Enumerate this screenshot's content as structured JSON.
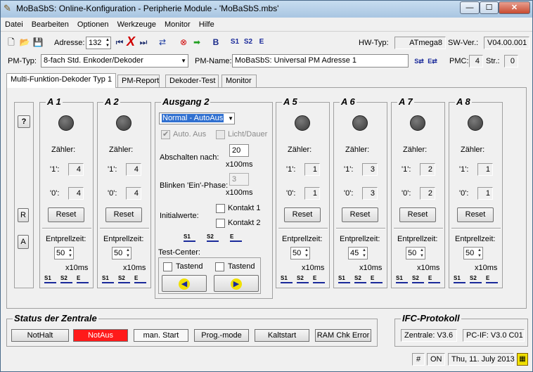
{
  "window": {
    "title": "MoBaSbS: Online-Konfiguration  -  Peripherie Module  -  'MoBaSbS.mbs'",
    "btn_min": "—",
    "btn_max": "☐",
    "btn_close": "✕"
  },
  "menu": [
    "Datei",
    "Bearbeiten",
    "Optionen",
    "Werkzeuge",
    "Monitor",
    "Hilfe"
  ],
  "toolbar": {
    "adresse_label": "Adresse:",
    "adresse_value": "132",
    "hwtyp_label": "HW-Typ:",
    "hwtyp_value": "ATmega8",
    "swver_label": "SW-Ver.:",
    "swver_value": "V04.00.001"
  },
  "pmbar": {
    "pmtyp_label": "PM-Typ:",
    "pmtyp_value": "8-fach Std. Enkoder/Dekoder",
    "pmname_label": "PM-Name:",
    "pmname_value": "MoBaSbS: Universal PM Adresse 1",
    "pmc_label": "PMC:",
    "pmc_value": "4",
    "str_label": "Str.:",
    "str_value": "0"
  },
  "tabs": [
    "Multi-Funktion-Dekoder Typ 1",
    "PM-Report",
    "Dekoder-Test",
    "Monitor"
  ],
  "side": {
    "help": "?",
    "r": "R",
    "a": "A"
  },
  "common": {
    "zaehler": "Zähler:",
    "one": "'1':",
    "zero": "'0':",
    "reset": "Reset",
    "entprell": "Entprellzeit:",
    "unit": "x10ms",
    "b1": "S1",
    "b2": "S2",
    "b3": "E"
  },
  "channels": [
    {
      "title": "A 1",
      "one": "4",
      "zero": "4",
      "entprell": "50"
    },
    {
      "title": "A 2",
      "one": "4",
      "zero": "4",
      "entprell": "50"
    },
    {
      "title": "A 5",
      "one": "1",
      "zero": "1",
      "entprell": "50"
    },
    {
      "title": "A 6",
      "one": "3",
      "zero": "3",
      "entprell": "45"
    },
    {
      "title": "A 7",
      "one": "2",
      "zero": "2",
      "entprell": "50"
    },
    {
      "title": "A 8",
      "one": "1",
      "zero": "1",
      "entprell": "50"
    }
  ],
  "ausgang2": {
    "title": "Ausgang 2",
    "mode": "Normal - AutoAus",
    "auto_aus": "Auto. Aus",
    "licht_dauer": "Licht/Dauer",
    "abschalten_label": "Abschalten nach:",
    "abschalten_value": "20",
    "abschalten_unit": "x100ms",
    "blinken_label": "Blinken 'Ein'-Phase:",
    "blinken_value": "3",
    "blinken_unit": "x100ms",
    "initial_label": "Initialwerte:",
    "kontakt1": "Kontakt 1",
    "kontakt2": "Kontakt 2",
    "testcenter": "Test-Center:",
    "tastend1": "Tastend",
    "tastend2": "Tastend"
  },
  "status": {
    "title": "Status der Zentrale",
    "buttons": [
      "NotHalt",
      "NotAus",
      "man. Start",
      "Prog.-mode",
      "Kaltstart",
      "RAM Chk Error"
    ],
    "notaus_color": "#ff0000"
  },
  "ifc": {
    "title": "IFC-Protokoll",
    "zentrale": "Zentrale: V3.6",
    "pcif": "PC-IF: V3.0 C01"
  },
  "statusbar": {
    "hash": "#",
    "on": "ON",
    "date": "Thu, 11. July 2013"
  }
}
